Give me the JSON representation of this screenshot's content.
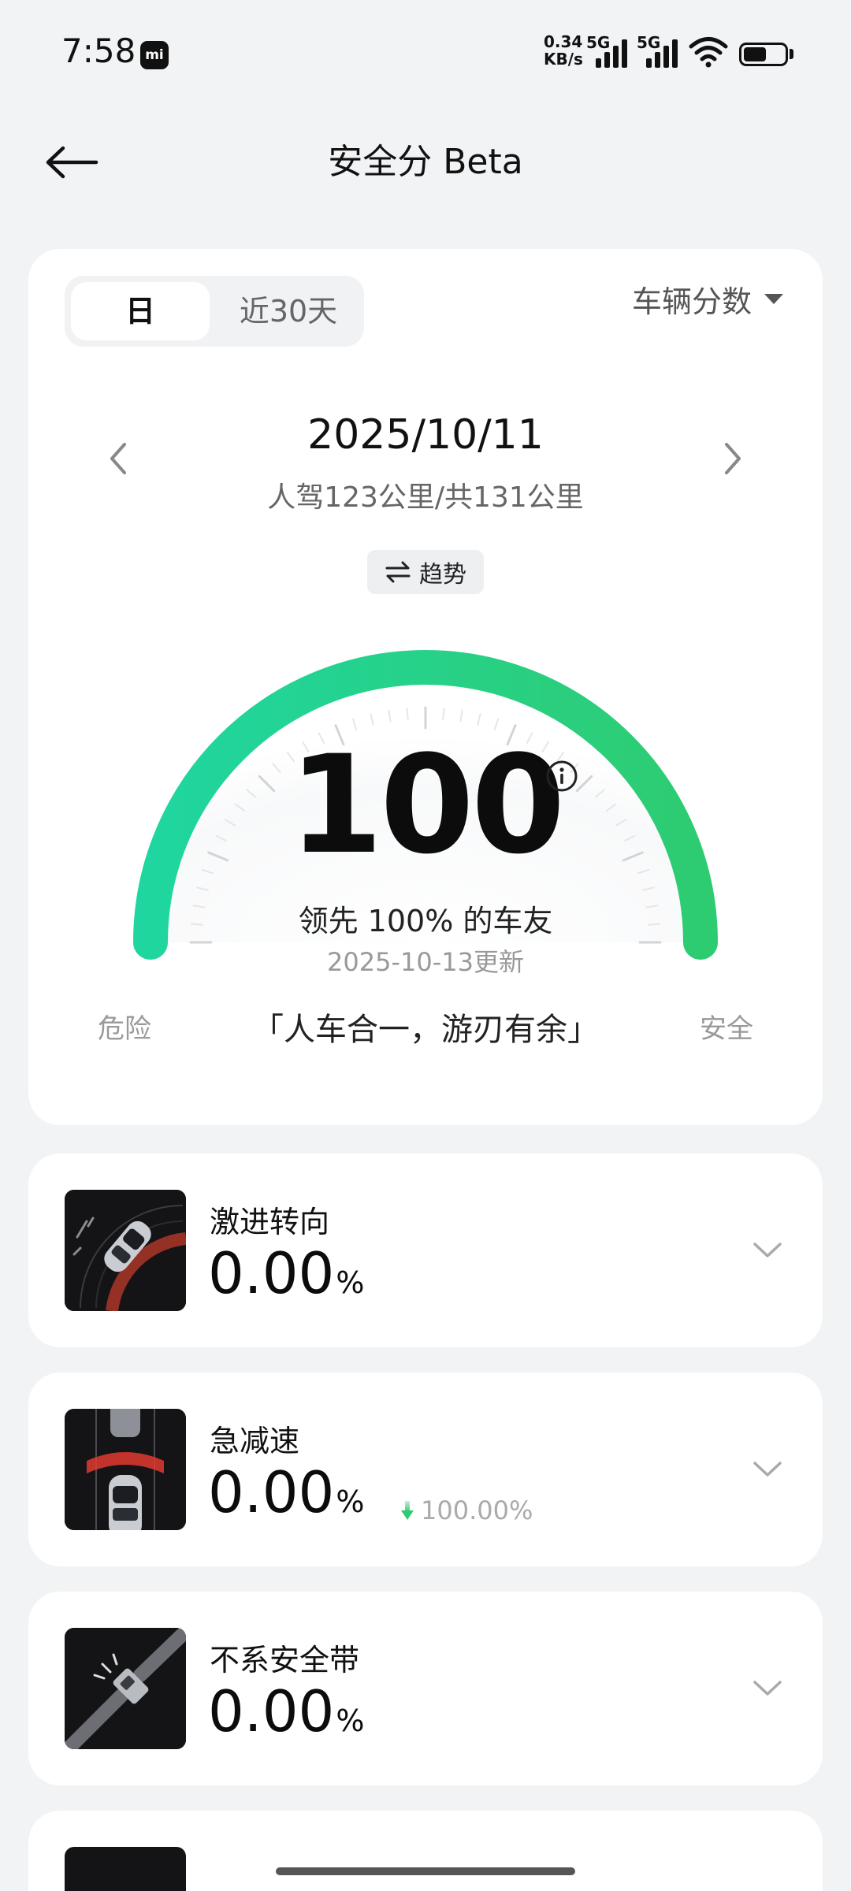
{
  "status_bar": {
    "time": "7:58",
    "app_icon_text": "mi",
    "net_speed_value": "0.34",
    "net_speed_unit": "KB/s",
    "sim1_label": "5G",
    "sim2_label": "5G",
    "battery_level": 0.55
  },
  "header": {
    "title": "安全分 Beta"
  },
  "score_card": {
    "tabs": [
      "日",
      "近30天"
    ],
    "active_tab": "日",
    "score_type": "车辆分数",
    "date": "2025/10/11",
    "distance": "人驾123公里/共131公里",
    "trend_label": "趋势",
    "score": "100",
    "rank_text": "领先 100% 的车友",
    "update_time": "2025-10-13更新",
    "label_danger": "危险",
    "label_safe": "安全",
    "slogan": "「人车合一，游刃有余」",
    "gauge_level": 1.0,
    "gauge_colors": [
      "#1fd6a0",
      "#2ecc71"
    ]
  },
  "metrics": [
    {
      "name": "激进转向",
      "value": "0.00",
      "unit": "%",
      "change": ""
    },
    {
      "name": "急减速",
      "value": "0.00",
      "unit": "%",
      "change": "100.00%"
    },
    {
      "name": "不系安全带",
      "value": "0.00",
      "unit": "%",
      "change": ""
    }
  ]
}
